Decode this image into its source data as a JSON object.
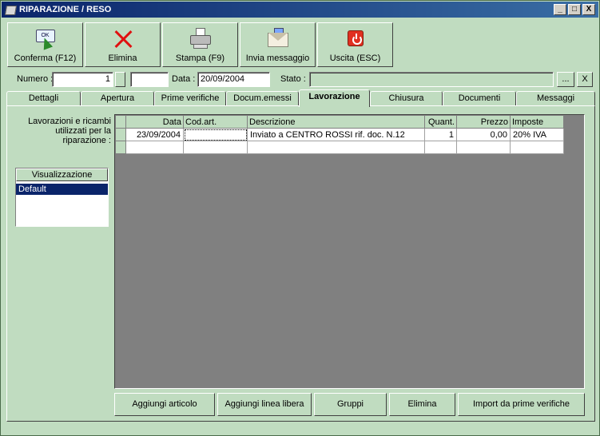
{
  "window": {
    "title": "RIPARAZIONE / RESO",
    "controls": [
      "_",
      "□",
      "X"
    ]
  },
  "toolbar": {
    "buttons": [
      {
        "label": "Conferma (F12)",
        "icon": "ok-screen-icon"
      },
      {
        "label": "Elimina",
        "icon": "delete-x-icon"
      },
      {
        "label": "Stampa (F9)",
        "icon": "printer-icon"
      },
      {
        "label": "Invia messaggio",
        "icon": "envelope-icon"
      },
      {
        "label": "Uscita (ESC)",
        "icon": "power-exit-icon"
      }
    ],
    "ok_icon_text": "OK"
  },
  "header": {
    "numero_label": "Numero :",
    "numero_value": "1",
    "numero_suffix": "",
    "data_label": "Data :",
    "data_value": "20/09/2004",
    "stato_label": "Stato :",
    "stato_value": "",
    "browse_label": "...",
    "clear_label": "X"
  },
  "tabs": [
    {
      "label": "Dettagli",
      "active": false
    },
    {
      "label": "Apertura",
      "active": false
    },
    {
      "label": "Prime verifiche",
      "active": false
    },
    {
      "label": "Docum.emessi",
      "active": false
    },
    {
      "label": "Lavorazione",
      "active": true
    },
    {
      "label": "Chiusura",
      "active": false
    },
    {
      "label": "Documenti",
      "active": false
    },
    {
      "label": "Messaggi",
      "active": false
    }
  ],
  "lavorazione": {
    "side_label": "Lavorazioni e ricambi utilizzati per la riparazione :",
    "visualizzazione": {
      "header": "Visualizzazione",
      "items": [
        "Default"
      ],
      "selected": "Default"
    },
    "grid": {
      "columns": [
        "Data",
        "Cod.art.",
        "Descrizione",
        "Quant.",
        "Prezzo",
        "Imposte"
      ],
      "rows": [
        [
          "23/09/2004",
          "",
          "Inviato a CENTRO ROSSI rif. doc. N.12",
          "1",
          "0,00",
          "20% IVA"
        ]
      ]
    },
    "buttons": [
      "Aggiungi articolo",
      "Aggiungi linea libera",
      "Gruppi",
      "Elimina",
      "Import da prime verifiche"
    ]
  }
}
